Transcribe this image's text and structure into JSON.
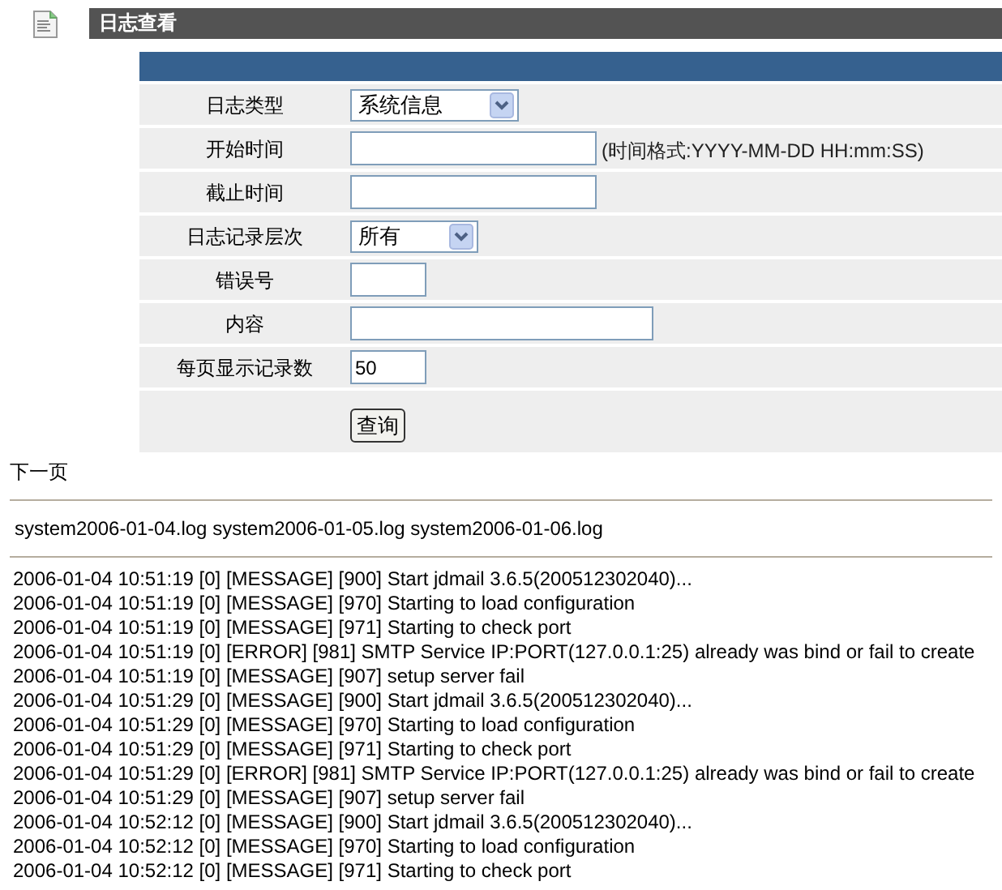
{
  "header": {
    "title": "日志查看"
  },
  "form": {
    "rows": [
      {
        "label": "日志类型",
        "kind": "select",
        "value": "系统信息"
      },
      {
        "label": "开始时间",
        "kind": "text",
        "hint": "(时间格式:YYYY-MM-DD HH:mm:SS)"
      },
      {
        "label": "截止时间",
        "kind": "text"
      },
      {
        "label": "日志记录层次",
        "kind": "select",
        "value": "所有"
      },
      {
        "label": "错误号",
        "kind": "text"
      },
      {
        "label": "内容",
        "kind": "text"
      },
      {
        "label": "每页显示记录数",
        "kind": "text",
        "value": "50"
      }
    ],
    "submit_button": "查询"
  },
  "next_page_link": "下一页",
  "log_files": [
    "system2006-01-04.log",
    "system2006-01-05.log",
    "system2006-01-06.log"
  ],
  "log_lines": [
    "2006-01-04 10:51:19 [0] [MESSAGE] [900] Start jdmail 3.6.5(200512302040)...",
    "2006-01-04 10:51:19 [0] [MESSAGE] [970] Starting to load configuration",
    "2006-01-04 10:51:19 [0] [MESSAGE] [971] Starting to check port",
    "2006-01-04 10:51:19 [0] [ERROR] [981] SMTP Service IP:PORT(127.0.0.1:25) already was bind or fail to create",
    "2006-01-04 10:51:19 [0] [MESSAGE] [907] setup server fail",
    "2006-01-04 10:51:29 [0] [MESSAGE] [900] Start jdmail 3.6.5(200512302040)...",
    "2006-01-04 10:51:29 [0] [MESSAGE] [970] Starting to load configuration",
    "2006-01-04 10:51:29 [0] [MESSAGE] [971] Starting to check port",
    "2006-01-04 10:51:29 [0] [ERROR] [981] SMTP Service IP:PORT(127.0.0.1:25) already was bind or fail to create",
    "2006-01-04 10:51:29 [0] [MESSAGE] [907] setup server fail",
    "2006-01-04 10:52:12 [0] [MESSAGE] [900] Start jdmail 3.6.5(200512302040)...",
    "2006-01-04 10:52:12 [0] [MESSAGE] [970] Starting to load configuration",
    "2006-01-04 10:52:12 [0] [MESSAGE] [971] Starting to check port"
  ]
}
